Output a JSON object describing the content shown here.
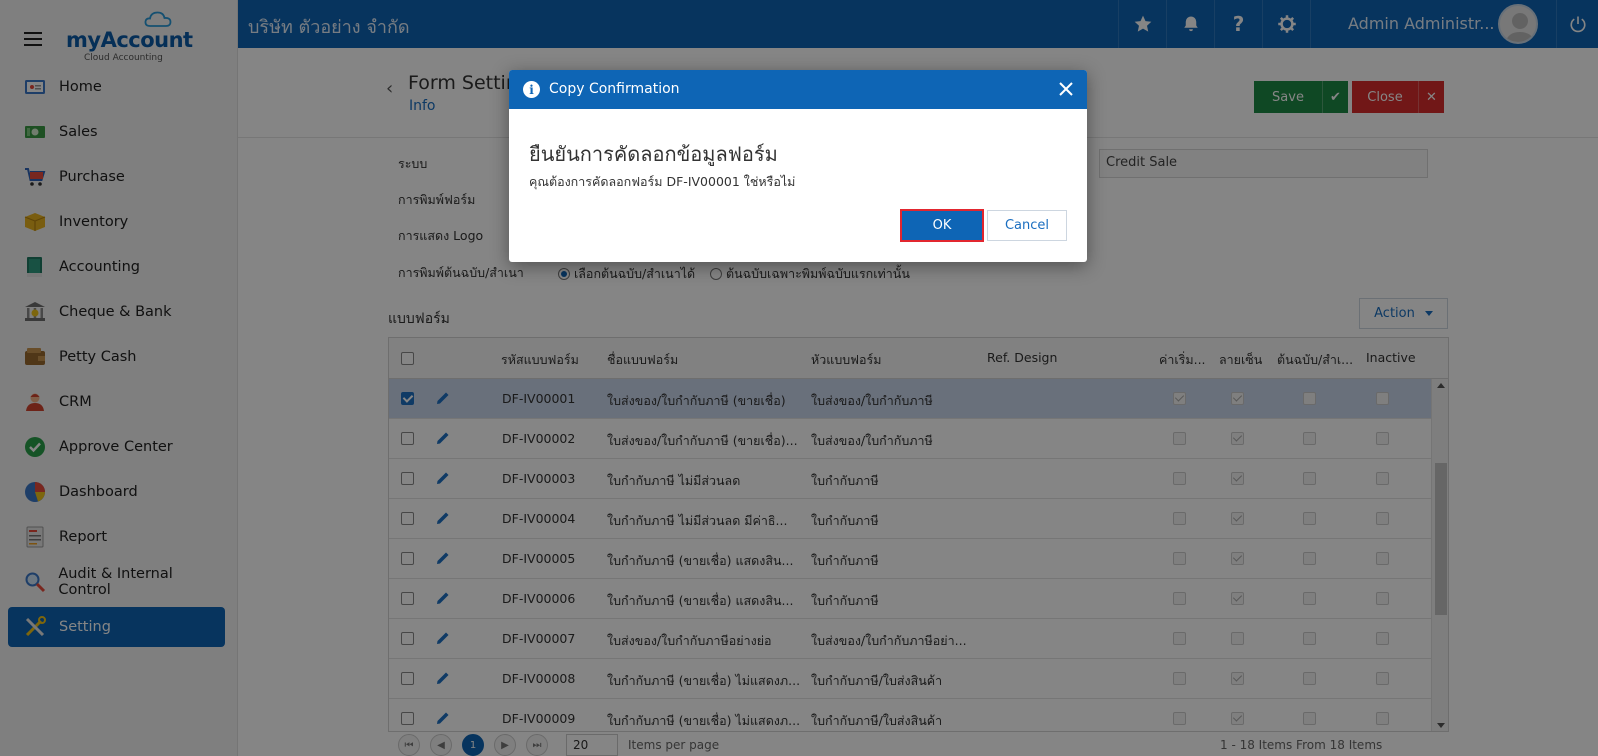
{
  "app": {
    "brand_my": "my",
    "brand_account": "Account",
    "brand_tag": "Cloud Accounting",
    "company": "บริษัท ตัวอย่าง จำกัด",
    "admin_name": "Admin Administr...",
    "accent": "#0e65b5"
  },
  "sidebar": {
    "items": [
      {
        "label": "Home",
        "icon": "home-icon"
      },
      {
        "label": "Sales",
        "icon": "sales-icon"
      },
      {
        "label": "Purchase",
        "icon": "cart-icon"
      },
      {
        "label": "Inventory",
        "icon": "box-icon"
      },
      {
        "label": "Accounting",
        "icon": "ledger-icon"
      },
      {
        "label": "Cheque & Bank",
        "icon": "bank-icon"
      },
      {
        "label": "Petty Cash",
        "icon": "wallet-icon"
      },
      {
        "label": "CRM",
        "icon": "people-icon"
      },
      {
        "label": "Approve Center",
        "icon": "check-circle-icon"
      },
      {
        "label": "Dashboard",
        "icon": "pie-chart-icon"
      },
      {
        "label": "Report",
        "icon": "report-icon"
      },
      {
        "label": "Audit & Internal Control",
        "icon": "magnifier-icon"
      },
      {
        "label": "Setting",
        "icon": "tools-icon",
        "active": true
      }
    ]
  },
  "header": {
    "title": "Form Settin",
    "subtitle": "Info",
    "save_label": "Save",
    "close_label": "Close"
  },
  "form": {
    "label_system": "ระบบ",
    "label_print": "การพิมพ์ฟอร์ม",
    "label_logo": "การแสดง Logo",
    "label_copy": "การพิมพ์ต้นฉบับ/สำเนา",
    "system_value": "Credit Sale",
    "radio1": "เลือกต้นฉบับ/สำเนาได้",
    "radio2": "ต้นฉบับเฉพาะพิมพ์ฉบับแรกเท่านั้น"
  },
  "section": {
    "title": "แบบฟอร์ม",
    "action_label": "Action"
  },
  "table": {
    "headers": {
      "code": "รหัสแบบฟอร์ม",
      "name": "ชื่อแบบฟอร์ม",
      "heading": "หัวแบบฟอร์ม",
      "ref": "Ref. Design",
      "default": "ค่าเริ่ม...",
      "signature": "ลายเซ็น",
      "original": "ต้นฉบับ/สำเ...",
      "inactive": "Inactive"
    },
    "rows": [
      {
        "code": "DF-IV00001",
        "name": "ใบส่งของ/ใบกำกับภาษี (ขายเชื่อ)",
        "heading": "ใบส่งของ/ใบกำกับภาษี",
        "selected": true,
        "default": true,
        "signature": true,
        "original": false,
        "inactive": false
      },
      {
        "code": "DF-IV00002",
        "name": "ใบส่งของ/ใบกำกับภาษี (ขายเชื่อ)...",
        "heading": "ใบส่งของ/ใบกำกับภาษี",
        "selected": false,
        "default": false,
        "signature": true,
        "original": false,
        "inactive": false
      },
      {
        "code": "DF-IV00003",
        "name": "ใบกำกับภาษี ไม่มีส่วนลด",
        "heading": "ใบกำกับภาษี",
        "selected": false,
        "default": false,
        "signature": true,
        "original": false,
        "inactive": false
      },
      {
        "code": "DF-IV00004",
        "name": "ใบกำกับภาษี ไม่มีส่วนลด มีค่าธิ...",
        "heading": "ใบกำกับภาษี",
        "selected": false,
        "default": false,
        "signature": true,
        "original": false,
        "inactive": false
      },
      {
        "code": "DF-IV00005",
        "name": "ใบกำกับภาษี (ขายเชื่อ) แสดงสิน...",
        "heading": "ใบกำกับภาษี",
        "selected": false,
        "default": false,
        "signature": true,
        "original": false,
        "inactive": false
      },
      {
        "code": "DF-IV00006",
        "name": "ใบกำกับภาษี (ขายเชื่อ) แสดงสิน...",
        "heading": "ใบกำกับภาษี",
        "selected": false,
        "default": false,
        "signature": true,
        "original": false,
        "inactive": false
      },
      {
        "code": "DF-IV00007",
        "name": "ใบส่งของ/ใบกำกับภาษีอย่างย่อ",
        "heading": "ใบส่งของ/ใบกำกับภาษีอย่า...",
        "selected": false,
        "default": false,
        "signature": false,
        "original": false,
        "inactive": false
      },
      {
        "code": "DF-IV00008",
        "name": "ใบกำกับภาษี (ขายเชื่อ) ไม่แสดงภ...",
        "heading": "ใบกำกับภาษี/ใบส่งสินค้า",
        "selected": false,
        "default": false,
        "signature": true,
        "original": false,
        "inactive": false
      },
      {
        "code": "DF-IV00009",
        "name": "ใบกำกับภาษี (ขายเชื่อ) ไม่แสดงภ...",
        "heading": "ใบกำกับภาษี/ใบส่งสินค้า",
        "selected": false,
        "default": false,
        "signature": true,
        "original": false,
        "inactive": false
      }
    ]
  },
  "pager": {
    "current": "1",
    "page_size": "20",
    "per_page_label": "Items per page",
    "summary": "1 - 18 Items From 18 Items"
  },
  "modal": {
    "title": "Copy Confirmation",
    "heading": "ยืนยันการคัดลอกข้อมูลฟอร์ม",
    "message": "คุณต้องการคัดลอกฟอร์ม DF-IV00001 ใช่หรือไม่",
    "ok_label": "OK",
    "cancel_label": "Cancel"
  }
}
